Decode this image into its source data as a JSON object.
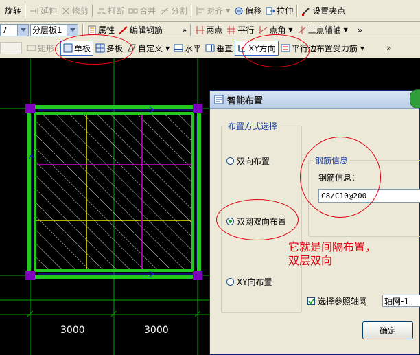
{
  "toolbar1": {
    "items": [
      {
        "label": "旋转",
        "icon": "rotate-icon",
        "disabled": false
      },
      {
        "label": "延伸",
        "icon": "extend-icon",
        "disabled": true
      },
      {
        "label": "修剪",
        "icon": "trim-icon",
        "disabled": true
      },
      {
        "label": "打断",
        "icon": "break-icon",
        "disabled": true
      },
      {
        "label": "合并",
        "icon": "merge-icon",
        "disabled": true
      },
      {
        "label": "分割",
        "icon": "split-icon",
        "disabled": true
      },
      {
        "label": "对齐",
        "icon": "align-icon",
        "disabled": true
      },
      {
        "label": "偏移",
        "icon": "offset-icon",
        "disabled": false
      },
      {
        "label": "拉伸",
        "icon": "stretch-icon",
        "disabled": false
      },
      {
        "label": "设置夹点",
        "icon": "grip-icon",
        "disabled": false
      }
    ]
  },
  "toolbar2": {
    "floor_value": "7",
    "layer_value": "分层板1",
    "property_label": "属性",
    "edit_rebar_label": "编辑钢筋",
    "more": "»",
    "two_point_label": "两点",
    "parallel_label": "平行",
    "point_angle_label": "点角",
    "three_point_aux_label": "三点辅轴",
    "more2": "»"
  },
  "toolbar3": {
    "rect_label": "矩形",
    "single_board_label": "单板",
    "multi_board_label": "多板",
    "custom_label": "自定义",
    "horizontal_label": "水平",
    "vertical_label": "垂直",
    "xy_direction_label": "XY方向",
    "parallel_edge_label": "平行边布置受力筋",
    "more": "»"
  },
  "canvas": {
    "dimensions": [
      "3000",
      "3000"
    ],
    "colors": {
      "background": "#000000",
      "beam": "#22c81e",
      "grid": "#00aa00",
      "magenta": "#d000d0",
      "yellow": "#e8e800"
    }
  },
  "dialog": {
    "title": "智能布置",
    "method_group_label": "布置方式选择",
    "radio_two_way": "双向布置",
    "radio_double_net": "双网双向布置",
    "radio_xy": "XY向布置",
    "selected_option": "双网双向布置",
    "rebar_group_label": "钢筋信息",
    "rebar_info_label": "钢筋信息：",
    "rebar_info_value": "C8/C10@200",
    "ref_axis_checkbox_label": "选择参照轴网",
    "ref_axis_checked": true,
    "axis_select_value": "轴网-1",
    "ok_label": "确定"
  },
  "annotation": {
    "line1": "它就是间隔布置，",
    "line2": "双层双向"
  }
}
